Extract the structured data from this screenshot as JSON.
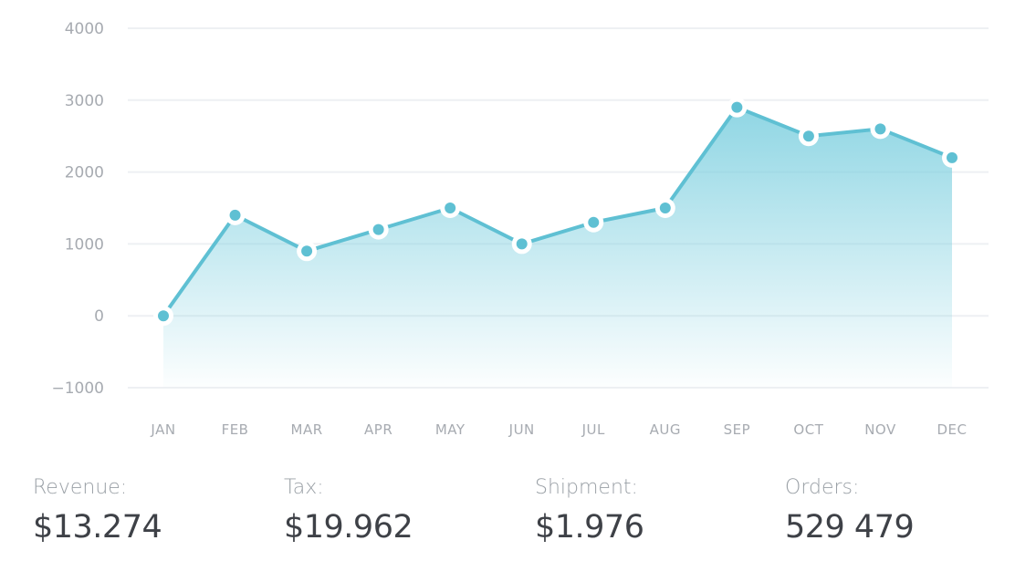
{
  "chart_data": {
    "type": "area",
    "categories": [
      "JAN",
      "FEB",
      "MAR",
      "APR",
      "MAY",
      "JUN",
      "JUL",
      "AUG",
      "SEP",
      "OCT",
      "NOV",
      "DEC"
    ],
    "series": [
      {
        "values": [
          0,
          1400,
          900,
          1200,
          1500,
          1000,
          1300,
          1500,
          2900,
          2500,
          2600,
          2200
        ]
      }
    ],
    "yticks": [
      4000,
      3000,
      2000,
      1000,
      0,
      -1000
    ],
    "ytick_labels": [
      "4000",
      "3000",
      "2000",
      "1000",
      "0",
      "−1000"
    ],
    "ylim": [
      -1000,
      4000
    ],
    "grid": true,
    "legend": "none",
    "colors": {
      "line": "#5fc0d3",
      "area_top": "#7ccfdf",
      "area_bottom": "#ffffff",
      "grid": "#eef0f3",
      "tick": "#a7abb1",
      "marker_fill": "#5fc0d3",
      "marker_ring": "#ffffff"
    }
  },
  "stats": [
    {
      "label": "Revenue:",
      "value": "$13.274"
    },
    {
      "label": "Tax:",
      "value": "$19.962"
    },
    {
      "label": "Shipment:",
      "value": "$1.976"
    },
    {
      "label": "Orders:",
      "value": "529 479"
    }
  ]
}
